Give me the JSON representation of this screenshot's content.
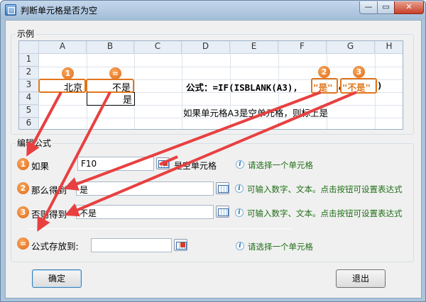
{
  "window": {
    "title": "判断单元格是否为空",
    "min_glyph": "—",
    "max_glyph": "▭",
    "close_glyph": "✕"
  },
  "example": {
    "group_label": "示例",
    "columns": [
      "A",
      "B",
      "C",
      "D",
      "E",
      "F",
      "G",
      "H"
    ],
    "rows": [
      "1",
      "2",
      "3",
      "4",
      "5",
      "6"
    ],
    "cell_a3": "北京",
    "cell_b3": "不是",
    "cell_b4": "是",
    "formula_prefix": "公式：=IF(ISBLANK(A3),",
    "formula_yes": "\"是\"",
    "formula_comma": ",",
    "formula_no": "\"不是\"",
    "formula_suffix": ")",
    "explanation": "如果单元格A3是空单元格，则标上是",
    "badges": {
      "one": "1",
      "eq": "=",
      "two": "2",
      "three": "3"
    }
  },
  "edit": {
    "group_label": "编辑公式",
    "if_label": "如果",
    "if_value": "F10",
    "if_after": "是空单元格",
    "if_hint": "请选择一个单元格",
    "then_label": "那么得到",
    "then_value": "是",
    "then_hint": "可输入数字、文本。点击按钮可设置表达式",
    "else_label": "否则得到",
    "else_value": "不是",
    "else_hint": "可输入数字、文本。点击按钮可设置表达式",
    "store_label": "公式存放到:",
    "store_value": "",
    "store_hint": "请选择一个单元格",
    "badges": {
      "one": "1",
      "two": "2",
      "three": "3",
      "eq": "="
    },
    "info_glyph": "i"
  },
  "buttons": {
    "ok": "确定",
    "exit": "退出"
  },
  "colors": {
    "accent_orange": "#e0761c",
    "arrow_red": "#e84040",
    "hint_green": "#1f6e16"
  }
}
